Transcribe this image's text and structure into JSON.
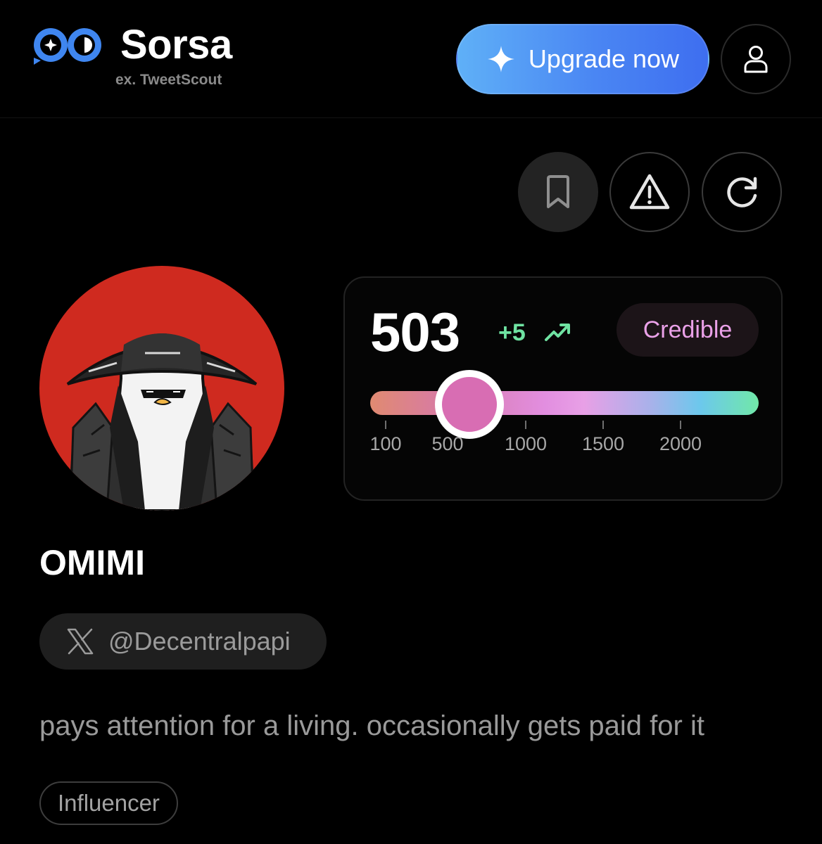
{
  "header": {
    "brand_name": "Sorsa",
    "brand_subtitle": "ex. TweetScout",
    "upgrade_label": "Upgrade now",
    "accent_gradient": [
      "#5fb0f7",
      "#3e6ef0"
    ]
  },
  "actions": {
    "icons": [
      "bookmark-icon",
      "alert-triangle-icon",
      "refresh-icon"
    ]
  },
  "profile": {
    "name": "OMIMI",
    "handle": "@Decentralpapi",
    "bio": "pays attention for a living. occasionally gets paid for it",
    "tags": [
      "Influencer"
    ],
    "avatar_bg": "#cf2a1f"
  },
  "score": {
    "value": "503",
    "delta": "+5",
    "badge": "Credible",
    "badge_color": "#eaa1e8",
    "delta_color": "#6fe3a2",
    "current": 503,
    "ticks": [
      "100",
      "500",
      "1000",
      "1500",
      "2000"
    ]
  }
}
